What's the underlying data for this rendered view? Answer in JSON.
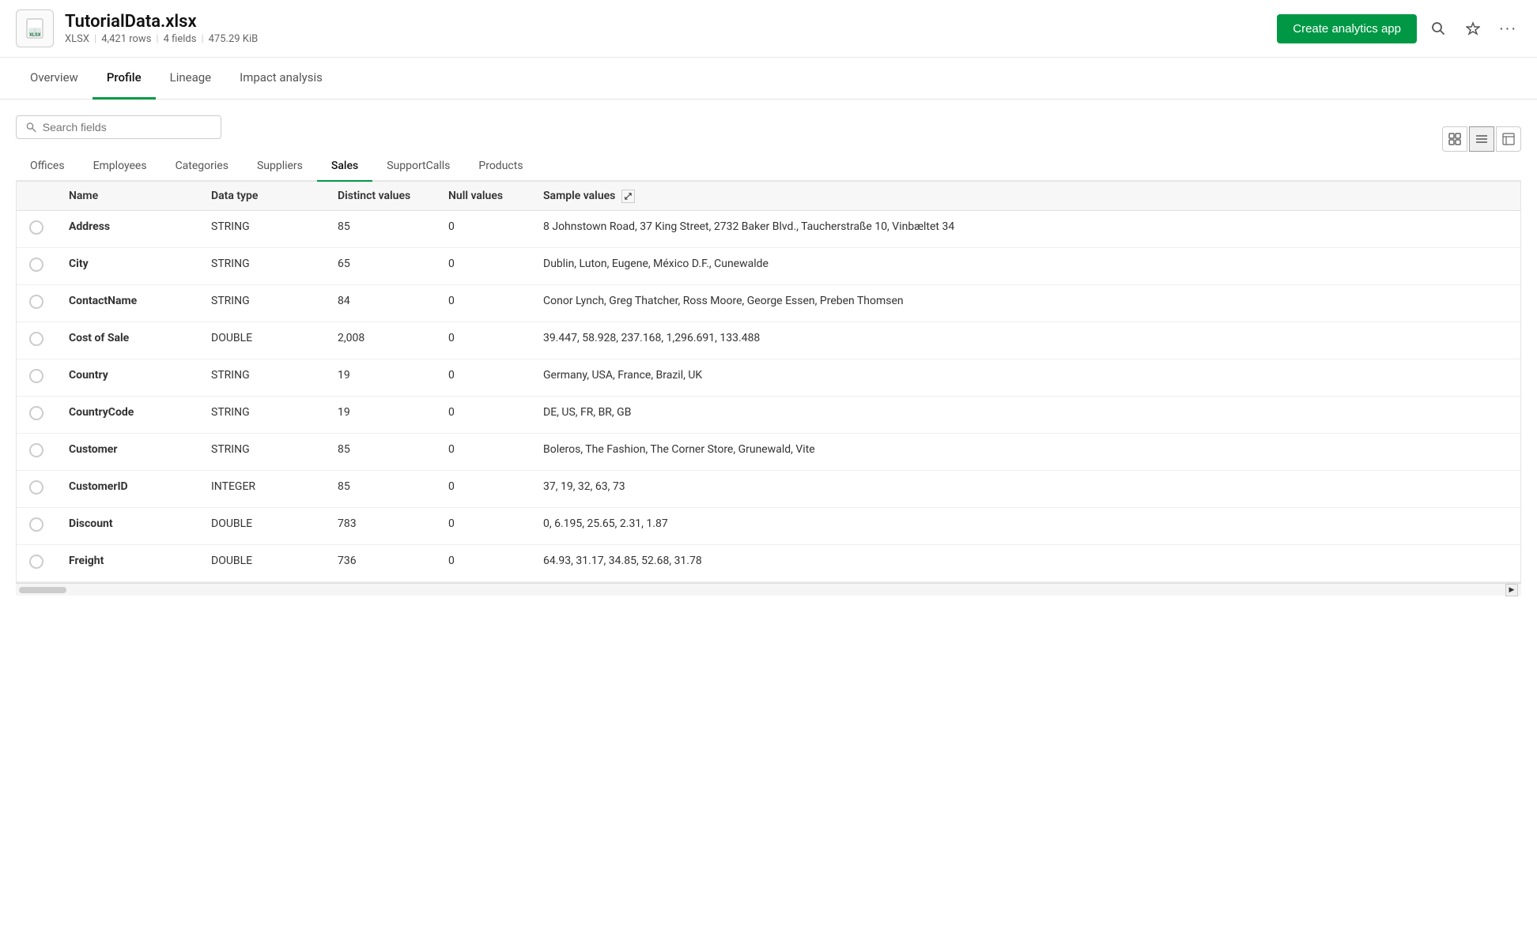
{
  "header": {
    "file_icon_label": "XLSX",
    "file_name": "TutorialData.xlsx",
    "file_type": "XLSX",
    "file_rows": "4,421 rows",
    "file_fields": "4 fields",
    "file_size": "475.29 KiB",
    "create_app_btn": "Create analytics app"
  },
  "tabs": [
    {
      "label": "Overview",
      "active": false
    },
    {
      "label": "Profile",
      "active": true
    },
    {
      "label": "Lineage",
      "active": false
    },
    {
      "label": "Impact analysis",
      "active": false
    }
  ],
  "search": {
    "placeholder": "Search fields",
    "value": ""
  },
  "sheet_tabs": [
    {
      "label": "Offices",
      "active": false
    },
    {
      "label": "Employees",
      "active": false
    },
    {
      "label": "Categories",
      "active": false
    },
    {
      "label": "Suppliers",
      "active": false
    },
    {
      "label": "Sales",
      "active": true
    },
    {
      "label": "SupportCalls",
      "active": false
    },
    {
      "label": "Products",
      "active": false
    }
  ],
  "table": {
    "columns": [
      {
        "key": "checkbox",
        "label": ""
      },
      {
        "key": "name",
        "label": "Name"
      },
      {
        "key": "data_type",
        "label": "Data type"
      },
      {
        "key": "distinct_values",
        "label": "Distinct values"
      },
      {
        "key": "null_values",
        "label": "Null values"
      },
      {
        "key": "sample_values",
        "label": "Sample values"
      }
    ],
    "rows": [
      {
        "name": "Address",
        "data_type": "STRING",
        "distinct_values": "85",
        "null_values": "0",
        "sample_values": "8 Johnstown Road, 37 King Street, 2732 Baker Blvd., Taucherstraße 10, Vinbæltet 34"
      },
      {
        "name": "City",
        "data_type": "STRING",
        "distinct_values": "65",
        "null_values": "0",
        "sample_values": "Dublin, Luton, Eugene, México D.F., Cunewalde"
      },
      {
        "name": "ContactName",
        "data_type": "STRING",
        "distinct_values": "84",
        "null_values": "0",
        "sample_values": "Conor Lynch, Greg Thatcher, Ross Moore, George Essen, Preben Thomsen"
      },
      {
        "name": "Cost of Sale",
        "data_type": "DOUBLE",
        "distinct_values": "2,008",
        "null_values": "0",
        "sample_values": "39.447, 58.928, 237.168, 1,296.691, 133.488"
      },
      {
        "name": "Country",
        "data_type": "STRING",
        "distinct_values": "19",
        "null_values": "0",
        "sample_values": "Germany, USA, France, Brazil, UK"
      },
      {
        "name": "CountryCode",
        "data_type": "STRING",
        "distinct_values": "19",
        "null_values": "0",
        "sample_values": "DE, US, FR, BR, GB"
      },
      {
        "name": "Customer",
        "data_type": "STRING",
        "distinct_values": "85",
        "null_values": "0",
        "sample_values": "Boleros, The Fashion, The Corner Store, Grunewald, Vite"
      },
      {
        "name": "CustomerID",
        "data_type": "INTEGER",
        "distinct_values": "85",
        "null_values": "0",
        "sample_values": "37, 19, 32, 63, 73"
      },
      {
        "name": "Discount",
        "data_type": "DOUBLE",
        "distinct_values": "783",
        "null_values": "0",
        "sample_values": "0, 6.195, 25.65, 2.31, 1.87"
      },
      {
        "name": "Freight",
        "data_type": "DOUBLE",
        "distinct_values": "736",
        "null_values": "0",
        "sample_values": "64.93, 31.17, 34.85, 52.68, 31.78"
      }
    ]
  }
}
